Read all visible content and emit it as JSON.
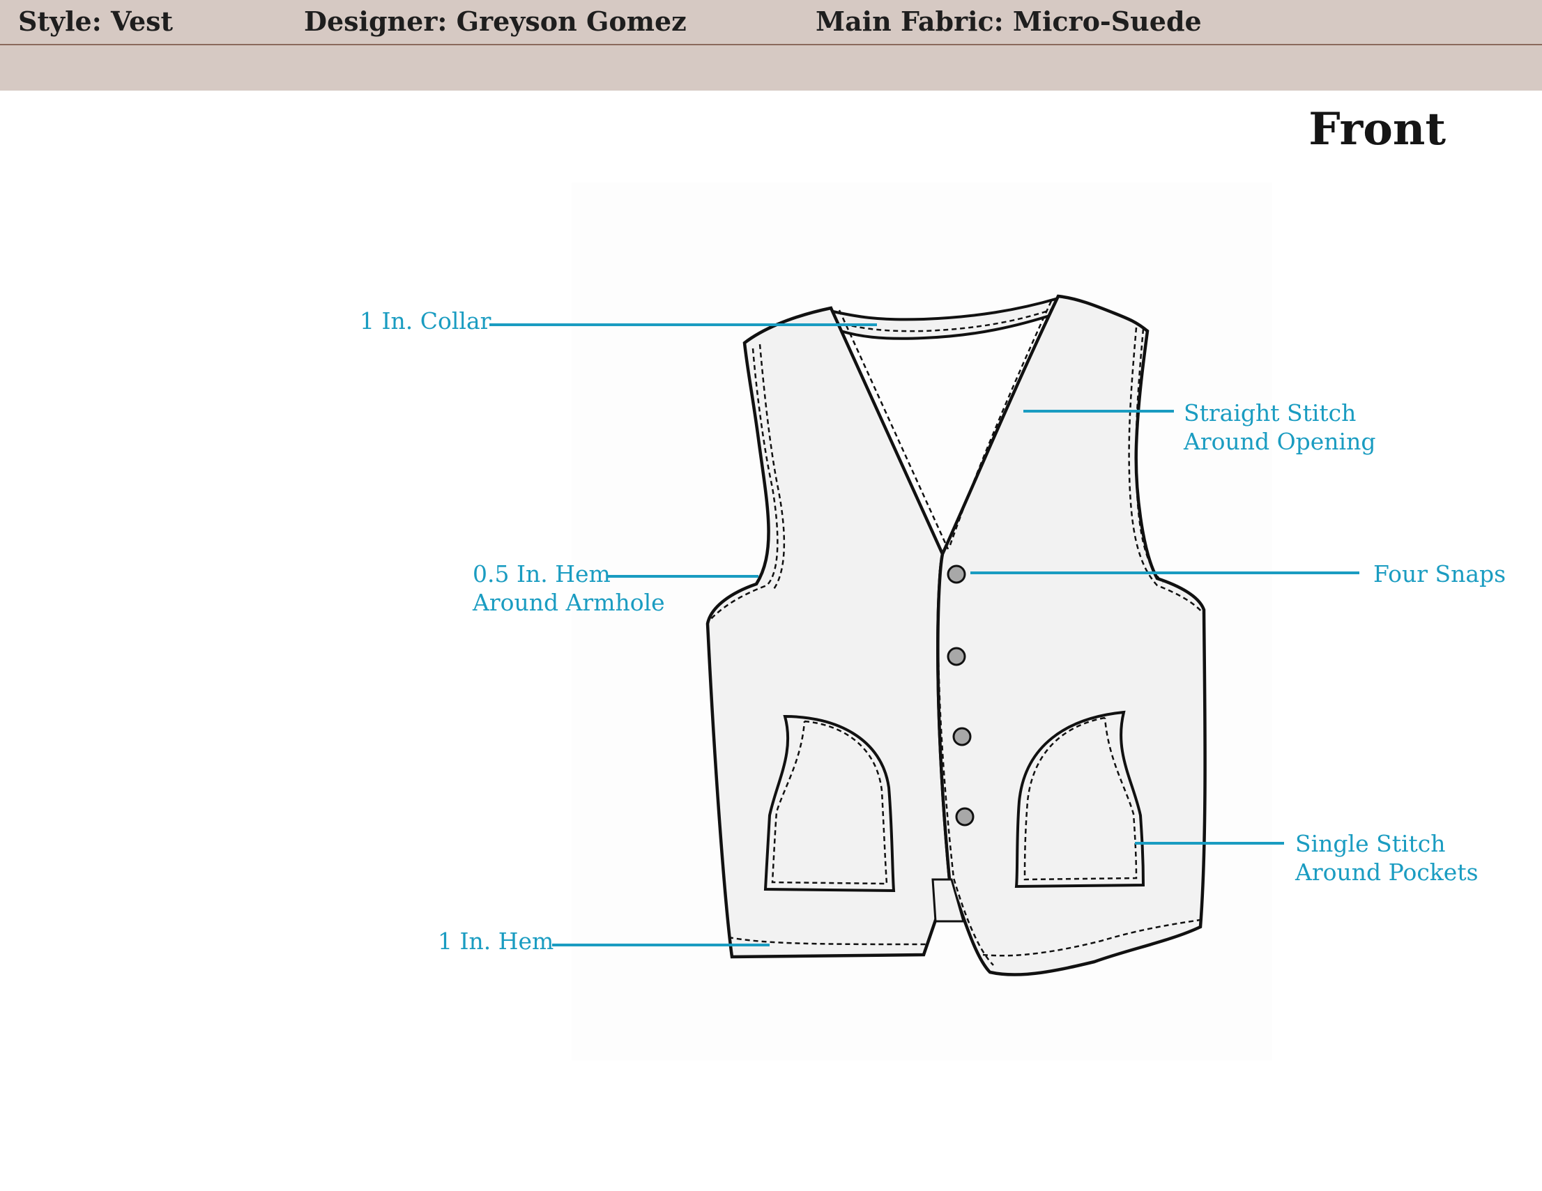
{
  "header": {
    "style": "Style: Vest",
    "designer": "Designer: Greyson Gomez",
    "fabric": "Main Fabric: Micro-Suede"
  },
  "view_title": "Front",
  "callouts": {
    "collar": "1 In. Collar",
    "opening_line1": "Straight Stitch",
    "opening_line2": "Around Opening",
    "armhole_line1": "0.5 In. Hem",
    "armhole_line2": "Around Armhole",
    "snaps": "Four Snaps",
    "pockets_line1": "Single Stitch",
    "pockets_line2": "Around Pockets",
    "hem": "1 In. Hem"
  },
  "colors": {
    "header_bg": "#d6c9c3",
    "callout": "#1a9cc1",
    "garment_fill": "#f2f2f2",
    "outline": "#111111",
    "snap_fill": "#a8a8a8"
  }
}
